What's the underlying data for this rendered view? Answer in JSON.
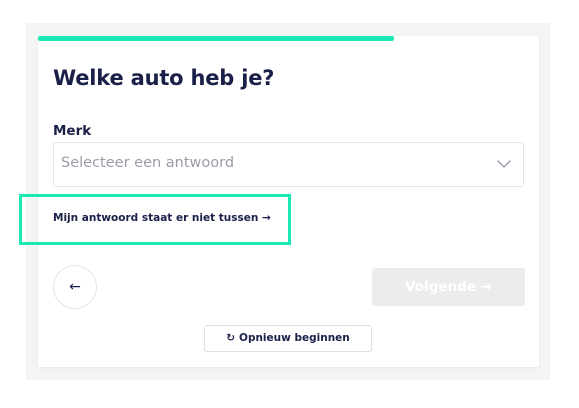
{
  "progress": {
    "value": 0.71,
    "color": "#1de9b6"
  },
  "question": {
    "title": "Welke auto heb je?"
  },
  "field": {
    "label": "Merk",
    "placeholder": "Selecteer een antwoord",
    "icon": "chevron-down-icon"
  },
  "not_listed_link": {
    "label": "Mijn antwoord staat er niet tussen →"
  },
  "navigation": {
    "back_label": "←",
    "next_label": "Volgende →",
    "restart_icon": "↻",
    "restart_label": "Opnieuw beginnen"
  },
  "colors": {
    "accent": "#1de9b6",
    "heading": "#1a1f47",
    "disabled_button": "#ececee"
  }
}
